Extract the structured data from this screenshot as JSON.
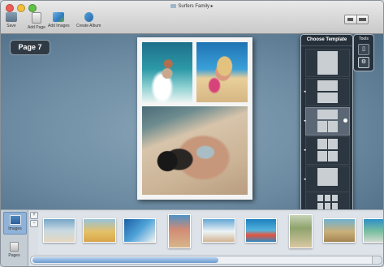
{
  "window": {
    "title": "Surfers Family"
  },
  "toolbar": {
    "save_label": "Save",
    "add_page_label": "Add Page",
    "add_images_label": "Add Images",
    "create_album_label": "Create Album"
  },
  "page": {
    "label": "Page 7"
  },
  "template_panel": {
    "title": "Choose Template",
    "selected_index": 2,
    "items": [
      "single-photo",
      "two-stacked",
      "three-photo",
      "four-grid",
      "single-photo-small",
      "nine-grid"
    ]
  },
  "tools_panel": {
    "title": "Tools"
  },
  "sidebar": {
    "images_label": "Images",
    "pages_label": "Pages"
  },
  "zoom": {
    "plus": "+",
    "minus": "−"
  },
  "colors": {
    "canvas": "#6c8ba2",
    "panel": "#26303a",
    "accent": "#6b9bd0",
    "selected_tab": "#8fb2d8"
  }
}
